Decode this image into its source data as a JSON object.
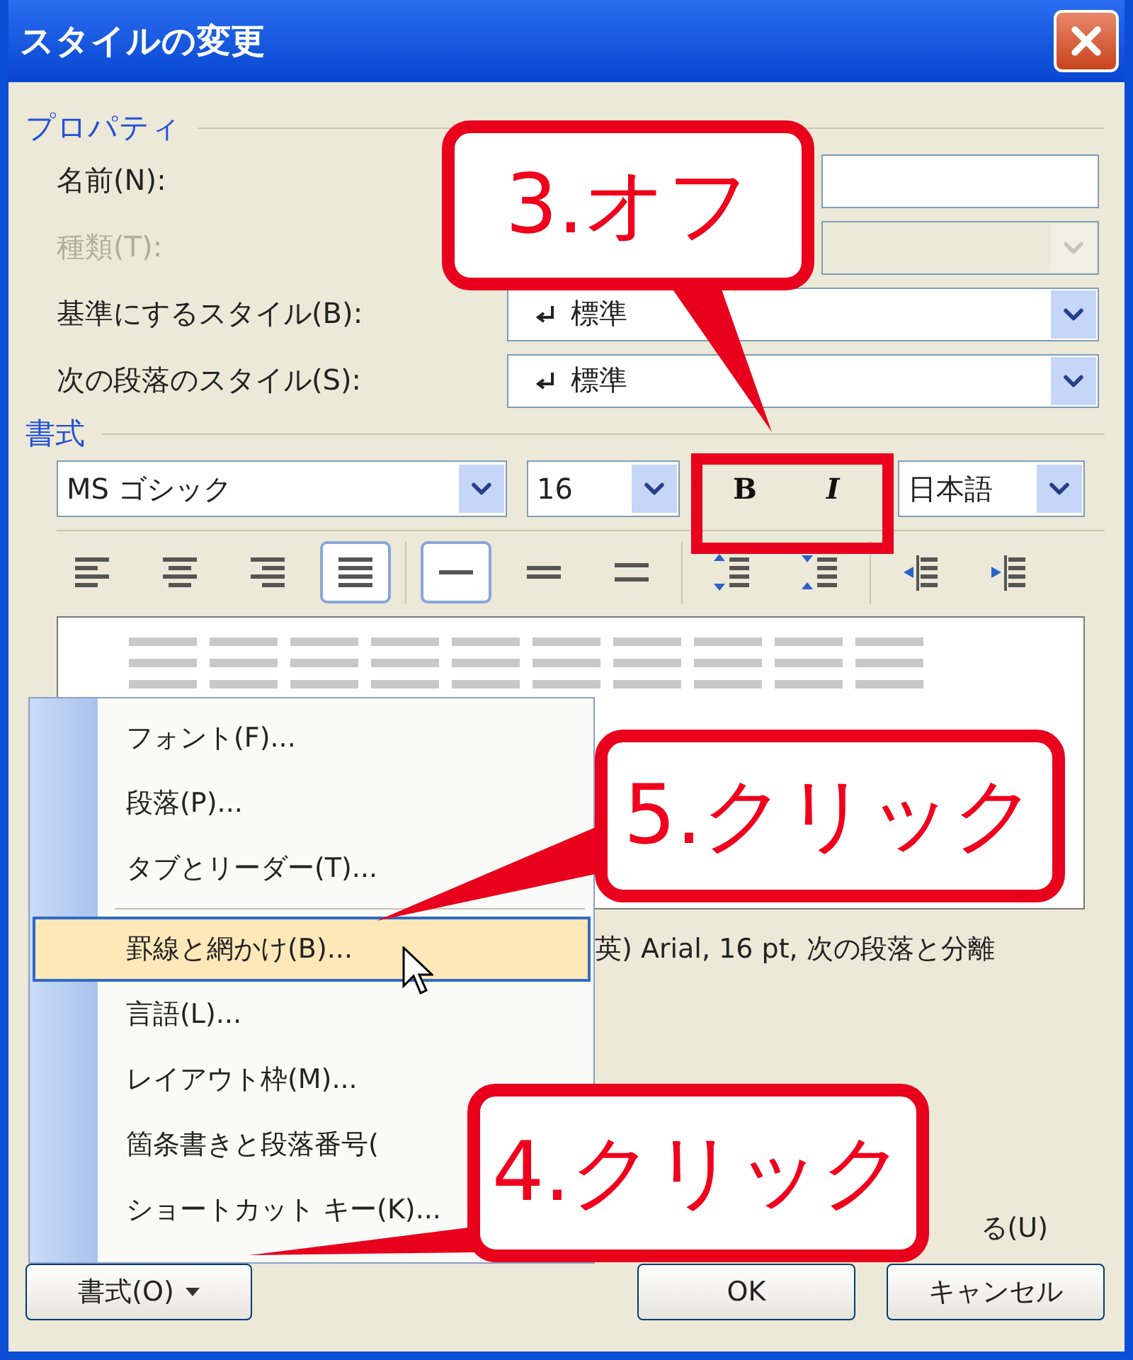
{
  "window": {
    "title": "スタイルの変更"
  },
  "properties": {
    "heading": "プロパティ",
    "fields": [
      {
        "label": "名前(N):",
        "kind": "text",
        "disabled": false
      },
      {
        "label": "種類(T):",
        "kind": "select",
        "disabled": true
      },
      {
        "label": "基準にするスタイル(B):",
        "kind": "select",
        "value": "標準",
        "disabled": false
      },
      {
        "label": "次の段落のスタイル(S):",
        "kind": "select",
        "value": "標準",
        "disabled": false
      }
    ]
  },
  "formatting": {
    "heading": "書式",
    "font": "MS ゴシック",
    "size": "16",
    "bold": {
      "label": "B",
      "on": false
    },
    "italic": {
      "label": "I",
      "on": false
    },
    "language": "日本語"
  },
  "toolbar": [
    [
      {
        "kind": "align-left",
        "selected": false
      },
      {
        "kind": "align-center",
        "selected": false
      },
      {
        "kind": "align-right",
        "selected": false
      },
      {
        "kind": "justify",
        "selected": true
      }
    ],
    [
      {
        "kind": "spacing-single",
        "selected": true
      },
      {
        "kind": "spacing-half",
        "selected": false
      },
      {
        "kind": "spacing-double",
        "selected": false
      }
    ],
    [
      {
        "kind": "space-increase",
        "selected": false
      },
      {
        "kind": "space-decrease",
        "selected": false
      }
    ],
    [
      {
        "kind": "indent-decrease",
        "selected": false
      },
      {
        "kind": "indent-increase",
        "selected": false
      }
    ]
  ],
  "description": "英) Arial, 16 pt, 次の段落と分離",
  "checkbox_text": "る(U)",
  "format_button": "書式(O)",
  "ok_button": "OK",
  "cancel_button": "キャンセル",
  "menu": {
    "groups": [
      [
        {
          "label": "フォント(F)...",
          "selected": false
        },
        {
          "label": "段落(P)...",
          "selected": false
        },
        {
          "label": "タブとリーダー(T)...",
          "selected": false
        }
      ],
      [
        {
          "label": "罫線と網かけ(B)...",
          "selected": true
        },
        {
          "label": "言語(L)...",
          "selected": false
        },
        {
          "label": "レイアウト枠(M)...",
          "selected": false
        },
        {
          "label": "箇条書きと段落番号(",
          "selected": false
        },
        {
          "label": "ショートカット キー(K)...",
          "selected": false
        }
      ]
    ]
  },
  "callouts": [
    {
      "text": "3.オフ"
    },
    {
      "text": "5.クリック"
    },
    {
      "text": "4.クリック"
    }
  ]
}
